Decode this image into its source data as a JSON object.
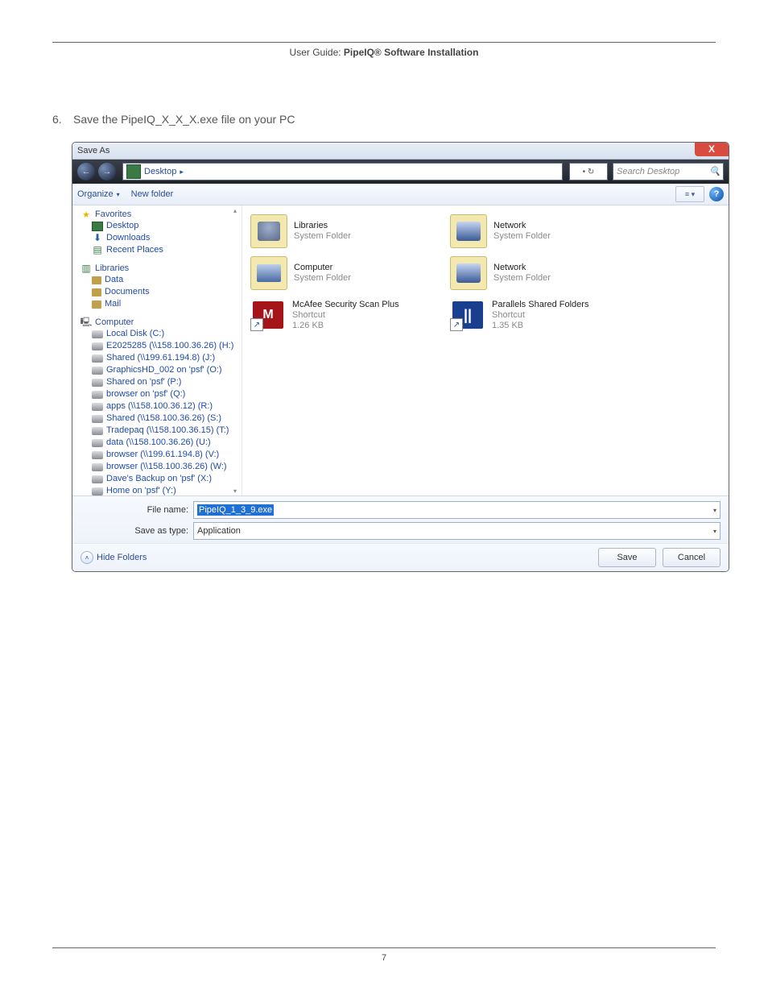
{
  "doc": {
    "header_left": "User Guide: ",
    "header_strong": "PipeIQ® Software Installation",
    "step_num": "6.",
    "step_text": "Save the PipeIQ_X_X_X.exe file on your PC",
    "page_number": "7"
  },
  "dialog": {
    "title": "Save As",
    "close_x": "X",
    "nav_back": "←",
    "nav_fwd": "→",
    "breadcrumb": "Desktop",
    "breadcrumb_arrow": "▸",
    "refresh_glyph": "• ↻",
    "search_placeholder": "Search Desktop",
    "toolbar_organize": "Organize",
    "toolbar_newfolder": "New folder",
    "view_glyph": "≡ ▾",
    "help_glyph": "?",
    "nav_favorites": "Favorites",
    "fav_items": [
      "Desktop",
      "Downloads",
      "Recent Places"
    ],
    "nav_libraries": "Libraries",
    "lib_items": [
      "Data",
      "Documents",
      "Mail"
    ],
    "nav_computer": "Computer",
    "comp_items": [
      "Local Disk (C:)",
      "E2025285 (\\\\158.100.36.26) (H:)",
      "Shared (\\\\199.61.194.8) (J:)",
      "GraphicsHD_002 on 'psf' (O:)",
      "Shared on 'psf' (P:)",
      "browser on 'psf' (Q:)",
      "apps (\\\\158.100.36.12) (R:)",
      "Shared (\\\\158.100.36.26) (S:)",
      "Tradepaq (\\\\158.100.36.15) (T:)",
      "data (\\\\158.100.36.26) (U:)",
      "browser (\\\\199.61.194.8) (V:)",
      "browser (\\\\158.100.36.26) (W:)",
      "Dave's Backup on 'psf' (X:)",
      "Home on 'psf' (Y:)"
    ],
    "tiles": [
      {
        "name": "Libraries",
        "meta": "System Folder",
        "kind": "lib"
      },
      {
        "name": "Network",
        "meta": "System Folder",
        "kind": "net"
      },
      {
        "name": "Computer",
        "meta": "System Folder",
        "kind": "comp"
      },
      {
        "name": "Network",
        "meta": "System Folder",
        "kind": "net"
      },
      {
        "name": "McAfee Security Scan Plus",
        "meta": "Shortcut",
        "meta2": "1.26 KB",
        "kind": "mcafee",
        "shortcut": true
      },
      {
        "name": "Parallels Shared Folders",
        "meta": "Shortcut",
        "meta2": "1.35 KB",
        "kind": "parallels",
        "shortcut": true
      }
    ],
    "filename_label": "File name:",
    "filename_value": "PipeIQ_1_3_9.exe",
    "savetype_label": "Save as type:",
    "savetype_value": "Application",
    "hide_folders": "Hide Folders",
    "btn_save": "Save",
    "btn_cancel": "Cancel"
  }
}
